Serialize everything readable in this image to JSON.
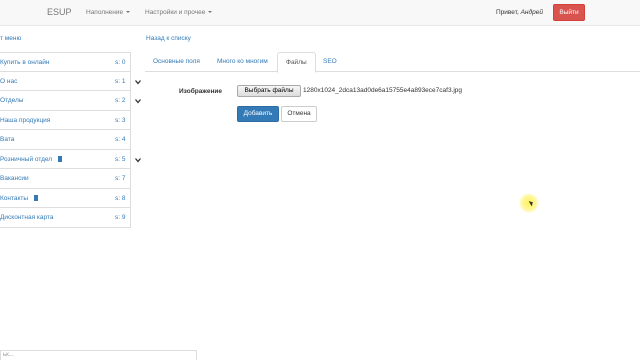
{
  "navbar": {
    "brand": "ESUP",
    "menu_content": "Наполнение",
    "menu_settings": "Настройки и прочее",
    "greeting_prefix": "Привет, ",
    "greeting_name": "Андрей",
    "logout_label": "Выйти"
  },
  "sidebar": {
    "menu_link": "т меню",
    "items": [
      {
        "label": "Купить в онлайн",
        "count": "s: 0",
        "has_doc": false,
        "expandable": false
      },
      {
        "label": "О нас",
        "count": "s: 1",
        "has_doc": false,
        "expandable": true
      },
      {
        "label": "Отделы",
        "count": "s: 2",
        "has_doc": false,
        "expandable": true
      },
      {
        "label": "Наша продукция",
        "count": "s: 3",
        "has_doc": false,
        "expandable": false
      },
      {
        "label": "Вата",
        "count": "s: 4",
        "has_doc": false,
        "expandable": false
      },
      {
        "label": "Розничный отдел",
        "count": "s: 5",
        "has_doc": true,
        "expandable": true
      },
      {
        "label": "Вакансии",
        "count": "s: 7",
        "has_doc": false,
        "expandable": false
      },
      {
        "label": "Контакты",
        "count": "s: 8",
        "has_doc": true,
        "expandable": false
      },
      {
        "label": "Дисконтная карта",
        "count": "s: 9",
        "has_doc": false,
        "expandable": false
      }
    ]
  },
  "main": {
    "back_link": "Назад к списку",
    "tabs": [
      {
        "label": "Основные поля",
        "active": false
      },
      {
        "label": "Много ко многим",
        "active": false
      },
      {
        "label": "Файлы",
        "active": true
      },
      {
        "label": "SEO",
        "active": false
      }
    ],
    "form": {
      "image_label": "Изображение",
      "choose_file_button": "Выбрать файлы",
      "file_name": "1280x1024_2dca13ad0de6a15755e4a893ece7caf3.jpg",
      "add_button": "Добавить",
      "cancel_button": "Отмена"
    }
  },
  "footer": {
    "input_text": "ьк..."
  },
  "colors": {
    "link": "#337ab7",
    "danger": "#d9534f",
    "primary": "#337ab7",
    "navbar_bg": "#f8f8f8"
  }
}
